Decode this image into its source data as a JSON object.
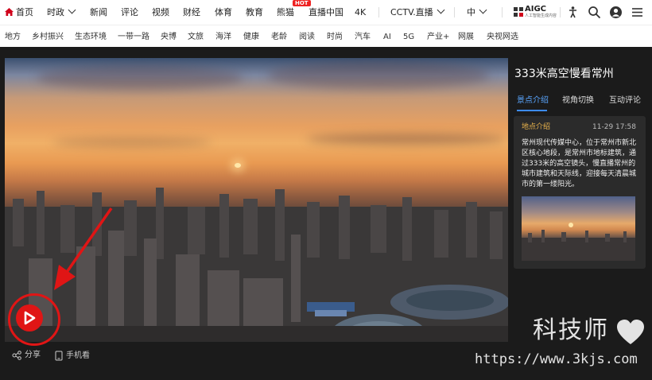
{
  "top_nav": {
    "items": [
      "首页",
      "时政",
      "新闻",
      "评论",
      "视频",
      "财经",
      "体育",
      "教育",
      "熊猫",
      "直播中国",
      "4K",
      "CCTV.直播",
      "中"
    ],
    "hot_badge": "HOT",
    "aigc_label": "AIGC",
    "aigc_sub": "人工智能生成内容",
    "icons": [
      "accessibility-icon",
      "search-icon",
      "user-icon",
      "menu-icon"
    ]
  },
  "sub_nav": {
    "items": [
      "地方",
      "乡村振兴",
      "生态环境",
      "一带一路",
      "央博",
      "文旅",
      "海洋",
      "健康",
      "老龄",
      "阅读",
      "时尚",
      "汽车",
      "AI",
      "5G",
      "产业+",
      "网展",
      "央视网选"
    ]
  },
  "player": {
    "share_label": "分享",
    "mobile_label": "手机看"
  },
  "panel": {
    "title": "333米高空慢看常州",
    "tabs": [
      "景点介绍",
      "视角切换",
      "互动评论"
    ],
    "card": {
      "heading": "地点介绍",
      "time": "11-29 17:58",
      "description": "常州现代传媒中心，位于常州市新北区核心地段，是常州市地标建筑，通过333米的高空镜头，慢直播常州的城市建筑和天际线，迎接每天清晨城市的第一缕阳光。"
    }
  },
  "watermark": {
    "name": "科技师",
    "url": "https://www.3kjs.com"
  },
  "colors": {
    "accent_red": "#e01515",
    "tab_active": "#3d8cff",
    "card_heading": "#e8b24c"
  }
}
